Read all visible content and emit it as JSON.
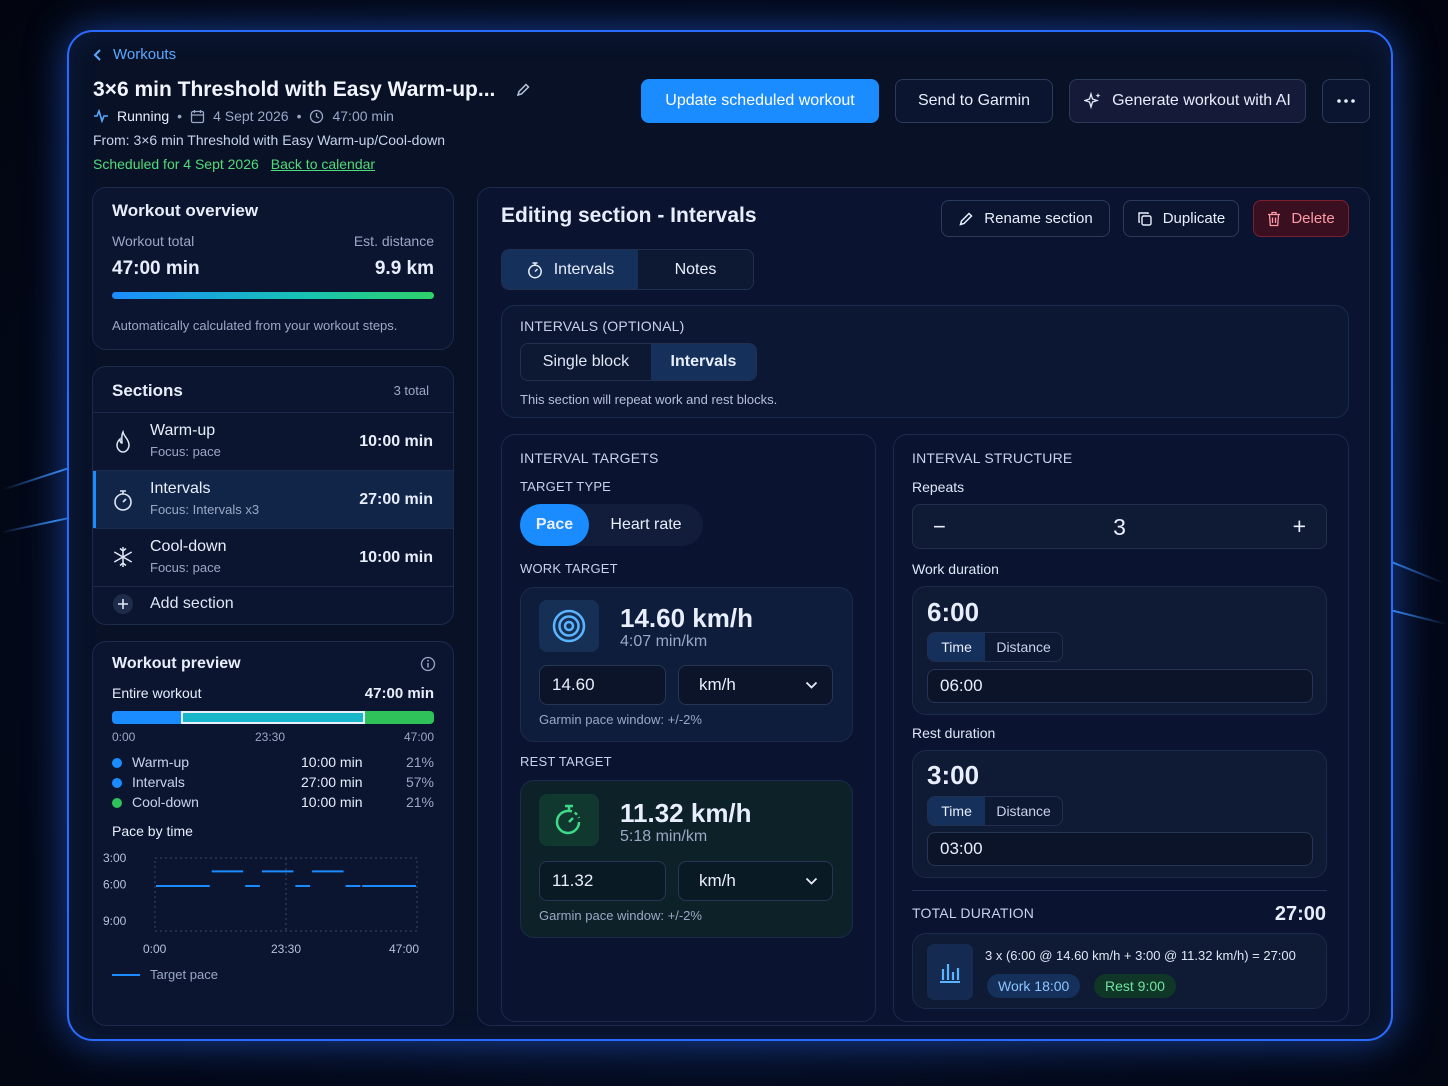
{
  "breadcrumb": {
    "back_label": "Workouts"
  },
  "header": {
    "title": "3×6 min Threshold with Easy Warm-up...",
    "sport": "Running",
    "date": "4 Sept 2026",
    "duration": "47:00 min",
    "from": "From: 3×6 min Threshold with Easy Warm-up/Cool-down",
    "scheduled": "Scheduled for 4 Sept 2026",
    "back_to_calendar": "Back to calendar"
  },
  "actions": {
    "update": "Update scheduled workout",
    "send": "Send to Garmin",
    "generate": "Generate workout with AI"
  },
  "overview": {
    "title": "Workout overview",
    "total_label": "Workout total",
    "distance_label": "Est. distance",
    "total_value": "47:00 min",
    "distance_value": "9.9 km",
    "note": "Automatically calculated from your workout steps."
  },
  "sections": {
    "title": "Sections",
    "count": "3 total",
    "items": [
      {
        "name": "Warm-up",
        "focus": "Focus: pace",
        "duration": "10:00 min",
        "icon": "flame-icon"
      },
      {
        "name": "Intervals",
        "focus": "Focus: Intervals x3",
        "duration": "27:00 min",
        "icon": "stopwatch-icon"
      },
      {
        "name": "Cool-down",
        "focus": "Focus: pace",
        "duration": "10:00 min",
        "icon": "snowflake-icon"
      }
    ],
    "add_label": "Add section"
  },
  "preview": {
    "title": "Workout preview",
    "entire_label": "Entire workout",
    "entire_value": "47:00 min",
    "bar_ticks": [
      "0:00",
      "23:30",
      "47:00"
    ],
    "legend": [
      {
        "name": "Warm-up",
        "duration": "10:00 min",
        "pct": "21%",
        "color": "#1a8cff"
      },
      {
        "name": "Intervals",
        "duration": "27:00 min",
        "pct": "57%",
        "color": "#1a8cff"
      },
      {
        "name": "Cool-down",
        "duration": "10:00 min",
        "pct": "21%",
        "color": "#2fc15a"
      }
    ],
    "pace_title": "Pace by time",
    "pace_legend": "Target pace"
  },
  "chart_data": {
    "type": "line",
    "title": "Pace by time",
    "y_ticks": [
      "3:00",
      "6:00",
      "9:00"
    ],
    "x_ticks": [
      "0:00",
      "23:30",
      "47:00"
    ],
    "ylim_min_per_km": [
      3,
      9
    ],
    "xlim_min": [
      0,
      47
    ],
    "series": [
      {
        "name": "Target pace",
        "segments_min": [
          {
            "x0": 0,
            "x1": 10,
            "pace": 5.3
          },
          {
            "x0": 10,
            "x1": 16,
            "pace": 4.1
          },
          {
            "x0": 16,
            "x1": 19,
            "pace": 5.3
          },
          {
            "x0": 19,
            "x1": 25,
            "pace": 4.1
          },
          {
            "x0": 25,
            "x1": 28,
            "pace": 5.3
          },
          {
            "x0": 28,
            "x1": 34,
            "pace": 4.1
          },
          {
            "x0": 34,
            "x1": 37,
            "pace": 5.3
          },
          {
            "x0": 37,
            "x1": 47,
            "pace": 5.3
          }
        ]
      }
    ]
  },
  "editor": {
    "title": "Editing section - Intervals",
    "rename": "Rename section",
    "duplicate": "Duplicate",
    "delete": "Delete",
    "tabs": [
      "Intervals",
      "Notes"
    ],
    "intervals_optional": "INTERVALS (OPTIONAL)",
    "mode_options": [
      "Single block",
      "Intervals"
    ],
    "mode_note": "This section will repeat work and rest blocks."
  },
  "targets": {
    "title": "INTERVAL TARGETS",
    "type_label": "TARGET TYPE",
    "type_options": [
      "Pace",
      "Heart rate"
    ],
    "work_label": "WORK TARGET",
    "work_speed": "14.60 km/h",
    "work_pace": "4:07 min/km",
    "work_value": "14.60",
    "work_unit": "km/h",
    "work_window": "Garmin pace window: +/-2%",
    "rest_label": "REST TARGET",
    "rest_speed": "11.32 km/h",
    "rest_pace": "5:18 min/km",
    "rest_value": "11.32",
    "rest_unit": "km/h",
    "rest_window": "Garmin pace window: +/-2%"
  },
  "structure": {
    "title": "INTERVAL STRUCTURE",
    "repeats_label": "Repeats",
    "repeats_value": "3",
    "minus": "−",
    "plus": "+",
    "work_label": "Work duration",
    "work_big": "6:00",
    "work_input": "06:00",
    "rest_label": "Rest duration",
    "rest_big": "3:00",
    "rest_input": "03:00",
    "mode_options": [
      "Time",
      "Distance"
    ],
    "total_label": "TOTAL DURATION",
    "total_value": "27:00",
    "formula": "3 x (6:00 @ 14.60 km/h + 3:00 @ 11.32 km/h) = 27:00",
    "work_chip": "Work 18:00",
    "rest_chip": "Rest 9:00"
  }
}
